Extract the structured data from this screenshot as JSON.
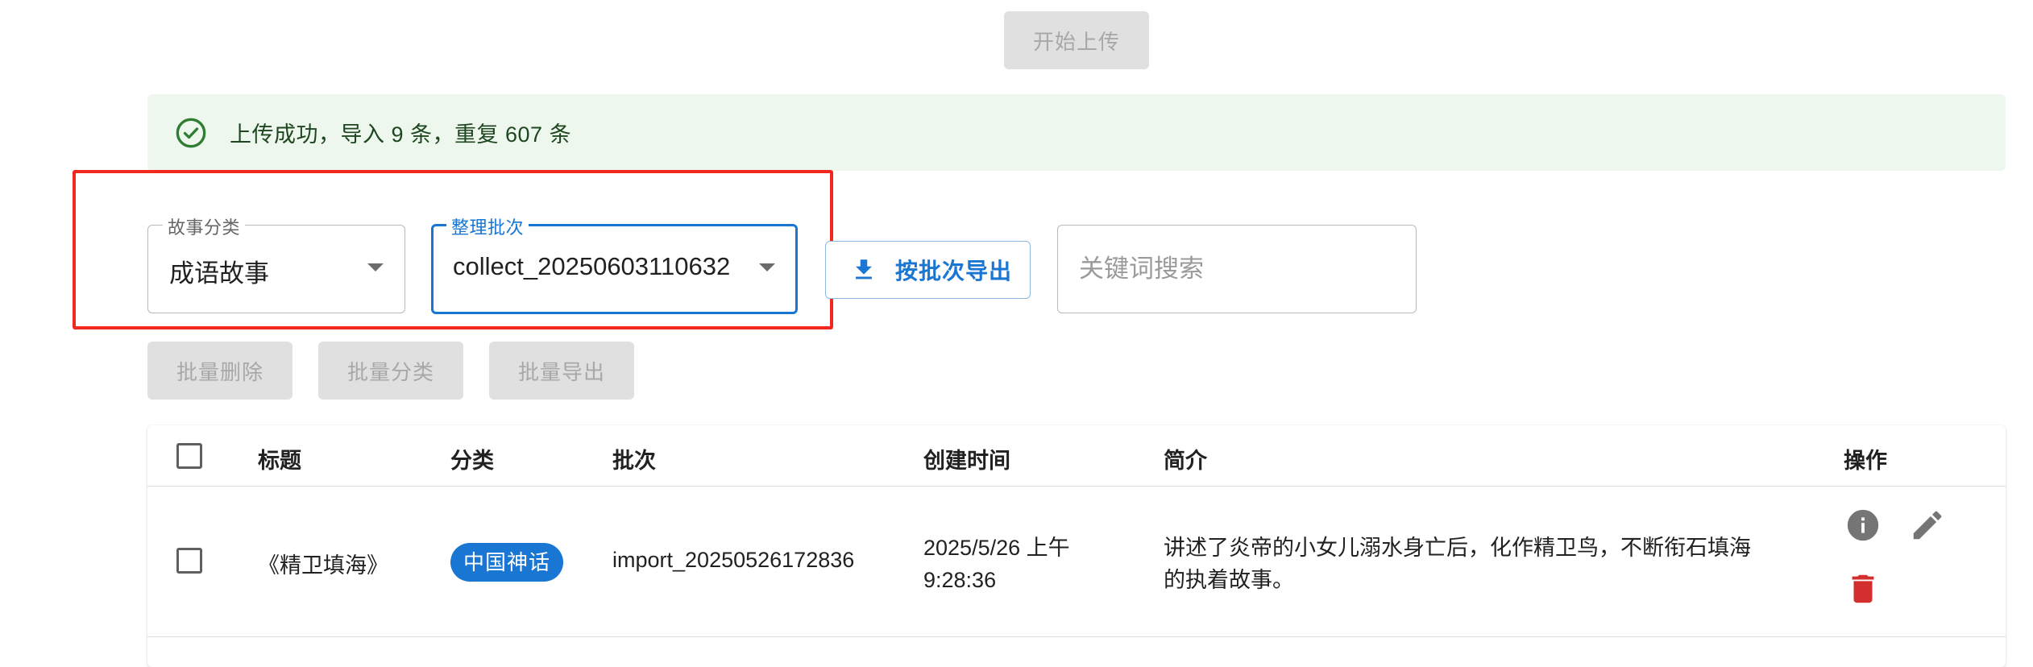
{
  "upload": {
    "start_label": "开始上传"
  },
  "alert": {
    "message": "上传成功，导入 9 条，重复 607 条"
  },
  "filters": {
    "category": {
      "legend": "故事分类",
      "value": "成语故事"
    },
    "batch": {
      "legend": "整理批次",
      "value": "collect_20250603110632"
    },
    "export_by_batch_label": "按批次导出",
    "search_placeholder": "关键词搜索"
  },
  "bulk_actions": {
    "delete_label": "批量删除",
    "classify_label": "批量分类",
    "export_label": "批量导出"
  },
  "table": {
    "headers": {
      "title": "标题",
      "category": "分类",
      "batch": "批次",
      "created": "创建时间",
      "summary": "简介",
      "actions": "操作"
    },
    "rows": [
      {
        "title": "《精卫填海》",
        "category": "中国神话",
        "batch": "import_20250526172836",
        "created_line1": "2025/5/26 上午",
        "created_line2": "9:28:36",
        "summary_line1": "讲述了炎帝的小女儿溺水身亡后，化作精卫鸟，不断衔石填海",
        "summary_line2": "的执着故事。"
      }
    ]
  },
  "colors": {
    "primary": "#1976d2",
    "success_bg": "#edf7ed",
    "success_icon": "#2e7d32",
    "danger": "#d32f2f",
    "highlight": "#f0281e"
  },
  "icons": {
    "alert": "check-circle-outline-icon",
    "export": "download-icon",
    "info": "info-icon",
    "edit": "pencil-icon",
    "delete": "trash-icon",
    "select_caret": "caret-down-icon"
  }
}
